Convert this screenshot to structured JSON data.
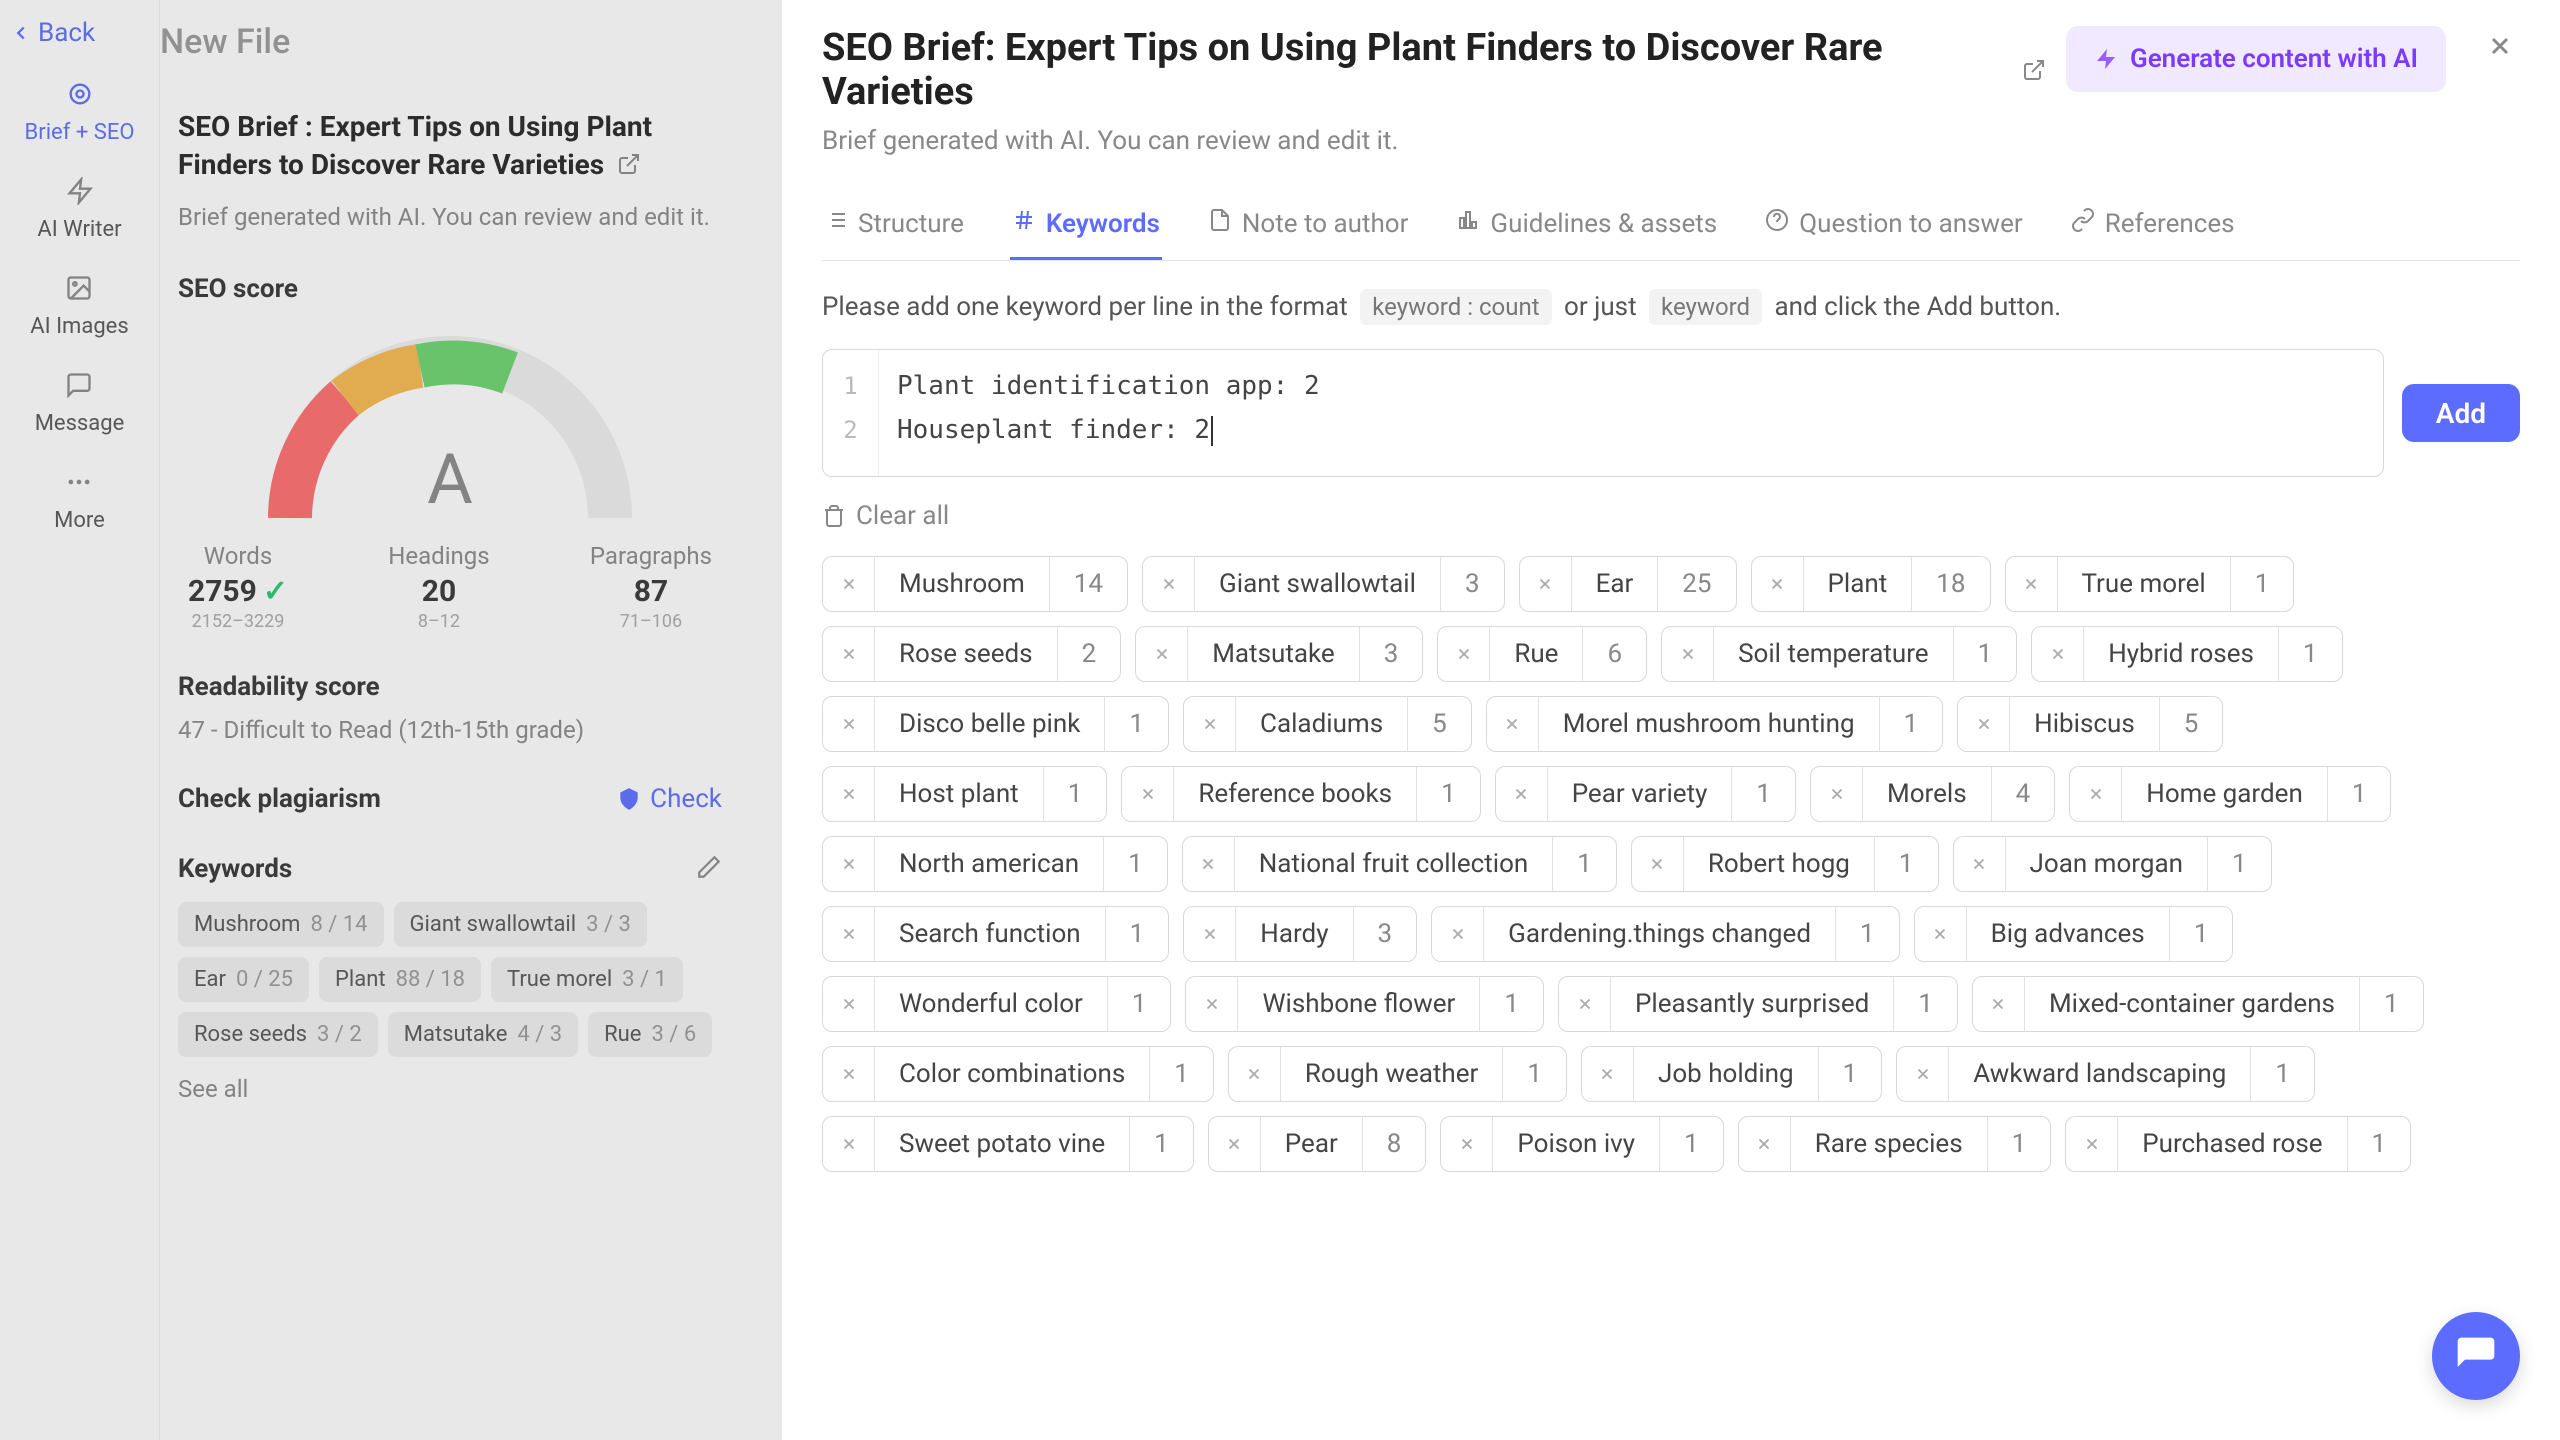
{
  "rail": {
    "back": "Back",
    "items": [
      {
        "label": "Brief + SEO"
      },
      {
        "label": "AI Writer"
      },
      {
        "label": "AI Images"
      },
      {
        "label": "Message"
      },
      {
        "label": "More"
      }
    ]
  },
  "newFile": "New File",
  "side": {
    "title": "SEO Brief : Expert Tips on Using Plant Finders to Discover Rare Varieties",
    "subtitle": "Brief generated with AI. You can review and edit it.",
    "seoScoreLabel": "SEO score",
    "gaugeLetter": "A",
    "metrics": {
      "words": {
        "label": "Words",
        "value": "2759",
        "range": "2152–3229"
      },
      "headings": {
        "label": "Headings",
        "value": "20",
        "range": "8–12"
      },
      "paragraphs": {
        "label": "Paragraphs",
        "value": "87",
        "range": "71–106"
      }
    },
    "readabilityLabel": "Readability score",
    "readabilityValue": "47 - Difficult to Read (12th-15th grade)",
    "plagiarismLabel": "Check plagiarism",
    "checkLabel": "Check",
    "keywordsLabel": "Keywords",
    "keywordTags": [
      {
        "name": "Mushroom",
        "count": "8 / 14"
      },
      {
        "name": "Giant swallowtail",
        "count": "3 / 3"
      },
      {
        "name": "Ear",
        "count": "0 / 25"
      },
      {
        "name": "Plant",
        "count": "88 / 18"
      },
      {
        "name": "True morel",
        "count": "3 / 1"
      },
      {
        "name": "Rose seeds",
        "count": "3 / 2"
      },
      {
        "name": "Matsutake",
        "count": "4 / 3"
      },
      {
        "name": "Rue",
        "count": "3 / 6"
      }
    ],
    "seeAll": "See all"
  },
  "modal": {
    "title": "SEO Brief: Expert Tips on Using Plant Finders to Discover Rare Varieties",
    "subtitle": "Brief generated with AI. You can review and edit it.",
    "generate": "Generate content with AI",
    "tabs": [
      {
        "label": "Structure"
      },
      {
        "label": "Keywords"
      },
      {
        "label": "Note to author"
      },
      {
        "label": "Guidelines & assets"
      },
      {
        "label": "Question to answer"
      },
      {
        "label": "References"
      }
    ],
    "hint_pre": "Please add one keyword per line in the format",
    "hint_kbox1": "keyword : count",
    "hint_mid": "or just",
    "hint_kbox2": "keyword",
    "hint_post": " and click the Add button.",
    "editorLines": [
      "Plant identification app: 2",
      "Houseplant finder: 2"
    ],
    "addLabel": "Add",
    "clearAll": "Clear all",
    "chips": [
      {
        "t": "Mushroom",
        "n": "14"
      },
      {
        "t": "Giant swallowtail",
        "n": "3"
      },
      {
        "t": "Ear",
        "n": "25"
      },
      {
        "t": "Plant",
        "n": "18"
      },
      {
        "t": "True morel",
        "n": "1"
      },
      {
        "t": "Rose seeds",
        "n": "2"
      },
      {
        "t": "Matsutake",
        "n": "3"
      },
      {
        "t": "Rue",
        "n": "6"
      },
      {
        "t": "Soil temperature",
        "n": "1"
      },
      {
        "t": "Hybrid roses",
        "n": "1"
      },
      {
        "t": "Disco belle pink",
        "n": "1"
      },
      {
        "t": "Caladiums",
        "n": "5"
      },
      {
        "t": "Morel mushroom hunting",
        "n": "1"
      },
      {
        "t": "Hibiscus",
        "n": "5"
      },
      {
        "t": "Host plant",
        "n": "1"
      },
      {
        "t": "Reference books",
        "n": "1"
      },
      {
        "t": "Pear variety",
        "n": "1"
      },
      {
        "t": "Morels",
        "n": "4"
      },
      {
        "t": "Home garden",
        "n": "1"
      },
      {
        "t": "North american",
        "n": "1"
      },
      {
        "t": "National fruit collection",
        "n": "1"
      },
      {
        "t": "Robert hogg",
        "n": "1"
      },
      {
        "t": "Joan morgan",
        "n": "1"
      },
      {
        "t": "Search function",
        "n": "1"
      },
      {
        "t": "Hardy",
        "n": "3"
      },
      {
        "t": "Gardening.things changed",
        "n": "1"
      },
      {
        "t": "Big advances",
        "n": "1"
      },
      {
        "t": "Wonderful color",
        "n": "1"
      },
      {
        "t": "Wishbone flower",
        "n": "1"
      },
      {
        "t": "Pleasantly surprised",
        "n": "1"
      },
      {
        "t": "Mixed-container gardens",
        "n": "1"
      },
      {
        "t": "Color combinations",
        "n": "1"
      },
      {
        "t": "Rough weather",
        "n": "1"
      },
      {
        "t": "Job holding",
        "n": "1"
      },
      {
        "t": "Awkward landscaping",
        "n": "1"
      },
      {
        "t": "Sweet potato vine",
        "n": "1"
      },
      {
        "t": "Pear",
        "n": "8"
      },
      {
        "t": "Poison ivy",
        "n": "1"
      },
      {
        "t": "Rare species",
        "n": "1"
      },
      {
        "t": "Purchased rose",
        "n": "1"
      }
    ]
  }
}
